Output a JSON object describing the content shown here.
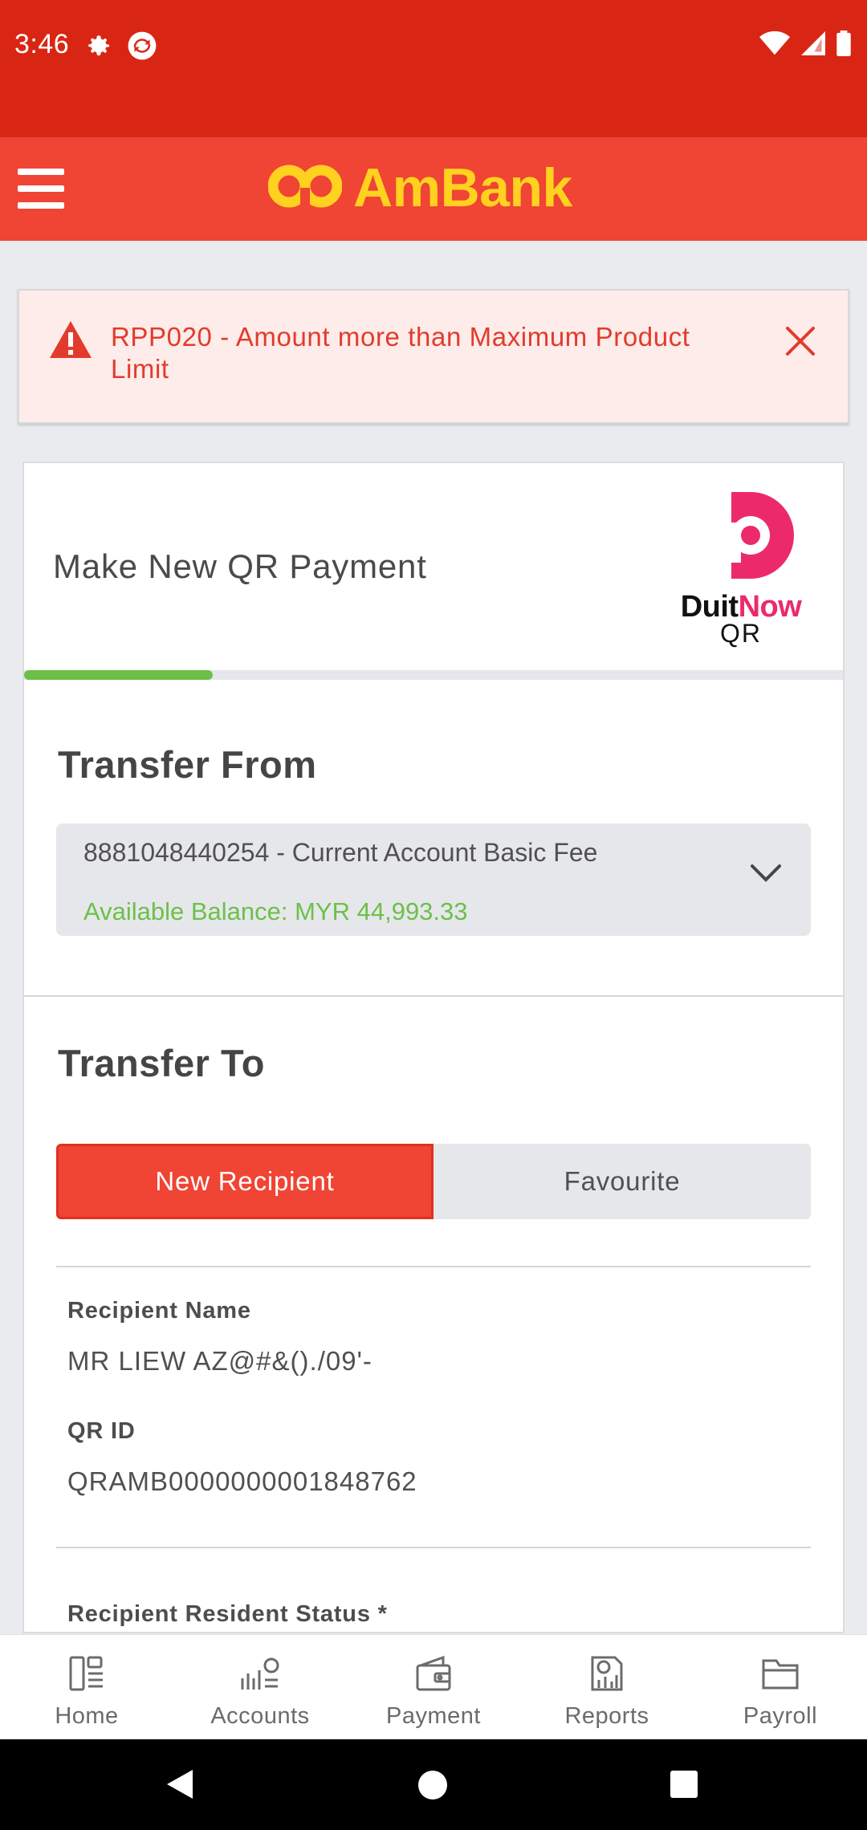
{
  "status_bar": {
    "time": "3:46",
    "icons_left": [
      "gear-icon",
      "sync-icon"
    ],
    "icons_right": [
      "wifi-icon",
      "signal-icon",
      "battery-icon"
    ]
  },
  "header": {
    "brand": "AmBank",
    "menu_icon": "hamburger-menu-icon",
    "colors": {
      "header_bg": "#f04434",
      "status_bg": "#d92614",
      "brand_yellow": "#ffd21f"
    }
  },
  "error_banner": {
    "message": "RPP020 - Amount more than Maximum Product Limit",
    "icon": "warning-icon",
    "close_icon": "close-icon",
    "color": "#e23b2c"
  },
  "page": {
    "title": "Make New QR Payment",
    "logo": {
      "word_a": "Duit",
      "word_b": "Now",
      "word_c": "QR"
    },
    "progress_fraction": 0.23
  },
  "transfer_from": {
    "title": "Transfer From",
    "account": "8881048440254 - Current Account Basic Fee",
    "balance": "Available Balance: MYR 44,993.33",
    "chevron_icon": "chevron-down-icon"
  },
  "transfer_to": {
    "title": "Transfer To",
    "tabs": [
      "New Recipient",
      "Favourite"
    ],
    "active_tab": 0,
    "recipient_name_label": "Recipient Name",
    "recipient_name_value": "MR LIEW AZ@#&()./09'-",
    "qr_id_label": "QR ID",
    "qr_id_value": "QRAMB0000000001848762",
    "resident_status_label": "Recipient Resident Status *"
  },
  "bottom_nav": {
    "items": [
      {
        "label": "Home",
        "icon": "home-icon"
      },
      {
        "label": "Accounts",
        "icon": "accounts-icon"
      },
      {
        "label": "Payment",
        "icon": "payment-wallet-icon"
      },
      {
        "label": "Reports",
        "icon": "reports-icon"
      },
      {
        "label": "Payroll",
        "icon": "payroll-folder-icon"
      }
    ]
  },
  "system_nav": {
    "icons": [
      "back-icon",
      "home-circle-icon",
      "recents-icon"
    ]
  }
}
